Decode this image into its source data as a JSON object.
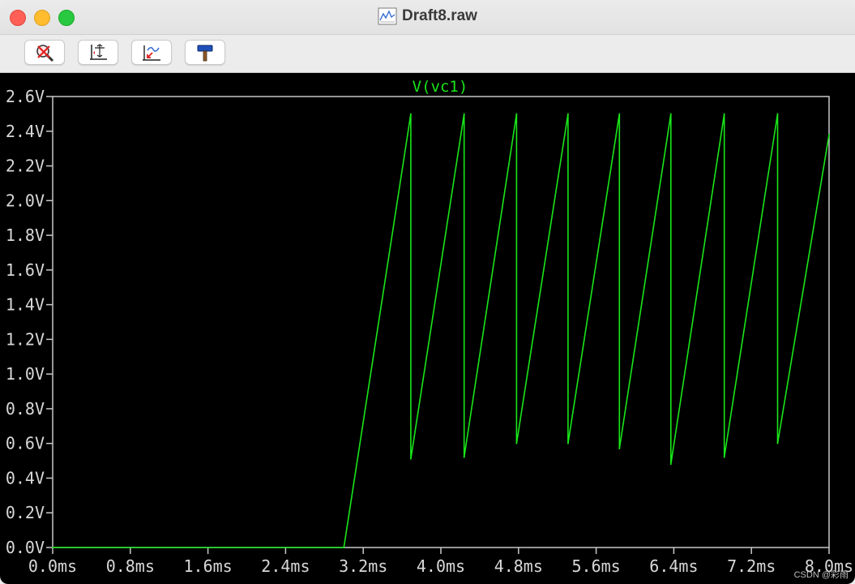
{
  "window": {
    "title": "Draft8.raw",
    "traffic_lights": {
      "close": "#fe5f57",
      "minimize": "#febc2e",
      "maximize": "#28c840"
    }
  },
  "toolbar": {
    "buttons": [
      {
        "name": "zoom-cancel",
        "icon": "magnifier-cancel-icon"
      },
      {
        "name": "autorange",
        "icon": "autorange-axes-icon"
      },
      {
        "name": "zoom-back",
        "icon": "zoom-back-icon"
      },
      {
        "name": "tools",
        "icon": "hammer-icon"
      }
    ]
  },
  "colors": {
    "background": "#000000",
    "grid_frame": "#c8c8c8",
    "trace": "#19e619",
    "tick_text": "#d8d8d8"
  },
  "chart_data": {
    "type": "line",
    "title": "V(vc1)",
    "xlabel": "",
    "ylabel": "",
    "xlim": [
      0,
      8.0
    ],
    "ylim": [
      0,
      2.6
    ],
    "grid": false,
    "x_ticks": [
      "0.0ms",
      "0.8ms",
      "1.6ms",
      "2.4ms",
      "3.2ms",
      "4.0ms",
      "4.8ms",
      "5.6ms",
      "6.4ms",
      "7.2ms",
      "8.0ms"
    ],
    "y_ticks": [
      "0.0V",
      "0.2V",
      "0.4V",
      "0.6V",
      "0.8V",
      "1.0V",
      "1.2V",
      "1.4V",
      "1.6V",
      "1.8V",
      "2.0V",
      "2.2V",
      "2.4V",
      "2.6V"
    ],
    "series": [
      {
        "name": "V(vc1)",
        "x": [
          0.0,
          3.0,
          3.69,
          3.69,
          4.24,
          4.24,
          4.78,
          4.78,
          5.31,
          5.31,
          5.84,
          5.84,
          6.37,
          6.37,
          6.92,
          6.92,
          7.47,
          7.47,
          8.0
        ],
        "y": [
          0.0,
          0.0,
          2.5,
          0.51,
          2.5,
          0.52,
          2.5,
          0.6,
          2.5,
          0.6,
          2.5,
          0.57,
          2.5,
          0.48,
          2.5,
          0.52,
          2.5,
          0.6,
          2.38
        ]
      }
    ]
  },
  "watermark": "CSDN @彩雨"
}
